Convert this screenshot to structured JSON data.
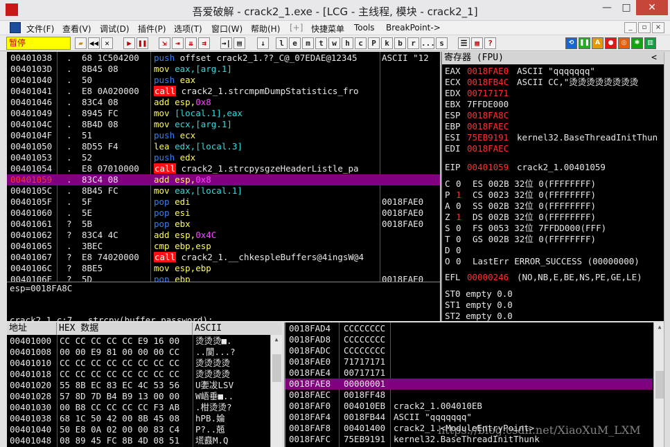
{
  "window": {
    "title": "吾爱破解 - crack2_1.exe - [LCG - 主线程, 模块 - crack2_1]",
    "icon_text": "吾爱破解",
    "controls": [
      "—",
      "□",
      "✕"
    ]
  },
  "menu": {
    "items": [
      "文件(F)",
      "查看(V)",
      "调试(D)",
      "插件(P)",
      "选项(T)",
      "窗口(W)",
      "帮助(H)",
      "[+]",
      "快捷菜单",
      "Tools",
      "BreakPoint->"
    ],
    "mdi_controls": [
      "_",
      "▫",
      "×"
    ]
  },
  "toolbar": {
    "status": "暂停",
    "letter_buttons": [
      "l",
      "e",
      "m",
      "t",
      "w",
      "h",
      "c",
      "P",
      "k",
      "b",
      "r",
      "...",
      "s"
    ]
  },
  "disasm": {
    "rows": [
      {
        "addr": "00401038",
        "mark": ".",
        "hex": "68 1C504200",
        "instr": [
          [
            "push",
            "b"
          ],
          [
            " offset crack2_1.??_C@_07EDAE@12345",
            "w"
          ]
        ],
        "cmt": "ASCII \"12"
      },
      {
        "addr": "0040103D",
        "mark": ".",
        "hex": "8B45 08",
        "instr": [
          [
            "mov",
            "y"
          ],
          [
            " eax,[arg.1]",
            "c"
          ]
        ],
        "cmt": ""
      },
      {
        "addr": "00401040",
        "mark": ".",
        "hex": "50",
        "instr": [
          [
            "push",
            "b"
          ],
          [
            " eax",
            "y"
          ]
        ],
        "cmt": ""
      },
      {
        "addr": "00401041",
        "mark": ".",
        "hex": "E8 0A020000",
        "instr": [
          [
            "call",
            "call"
          ],
          [
            " crack2_1.strcmpmDumpStatistics_fro",
            "w"
          ]
        ],
        "cmt": ""
      },
      {
        "addr": "00401046",
        "mark": ".",
        "hex": "83C4 08",
        "instr": [
          [
            "add",
            "y"
          ],
          [
            " esp,",
            "y"
          ],
          [
            "0x8",
            "m"
          ]
        ],
        "cmt": ""
      },
      {
        "addr": "00401049",
        "mark": ".",
        "hex": "8945 FC",
        "instr": [
          [
            "mov",
            "y"
          ],
          [
            " [local.1],eax",
            "c"
          ]
        ],
        "cmt": ""
      },
      {
        "addr": "0040104C",
        "mark": ".",
        "hex": "8B4D 08",
        "instr": [
          [
            "mov",
            "y"
          ],
          [
            " ecx,[arg.1]",
            "c"
          ]
        ],
        "cmt": ""
      },
      {
        "addr": "0040104F",
        "mark": ".",
        "hex": "51",
        "instr": [
          [
            "push",
            "b"
          ],
          [
            " ecx",
            "y"
          ]
        ],
        "cmt": ""
      },
      {
        "addr": "00401050",
        "mark": ".",
        "hex": "8D55 F4",
        "instr": [
          [
            "lea",
            "y"
          ],
          [
            " edx,[local.3]",
            "c"
          ]
        ],
        "cmt": ""
      },
      {
        "addr": "00401053",
        "mark": ".",
        "hex": "52",
        "instr": [
          [
            "push",
            "b"
          ],
          [
            " edx",
            "y"
          ]
        ],
        "cmt": ""
      },
      {
        "addr": "00401054",
        "mark": ".",
        "hex": "E8 07010000",
        "instr": [
          [
            "call",
            "call"
          ],
          [
            " crack2_1.strcpysgzeHeaderListle_pa",
            "w"
          ]
        ],
        "cmt": ""
      },
      {
        "addr": "00401059",
        "mark": ".",
        "hex": "83C4 08",
        "instr": [
          [
            "add",
            "y"
          ],
          [
            " esp,",
            "y"
          ],
          [
            "0x8",
            "m"
          ]
        ],
        "cmt": "",
        "selected": true
      },
      {
        "addr": "0040105C",
        "mark": ".",
        "hex": "8B45 FC",
        "instr": [
          [
            "mov",
            "y"
          ],
          [
            " eax,[local.1]",
            "c"
          ]
        ],
        "cmt": ""
      },
      {
        "addr": "0040105F",
        "mark": ".",
        "hex": "5F",
        "instr": [
          [
            "pop",
            "b"
          ],
          [
            " edi",
            "y"
          ]
        ],
        "cmt": "0018FAE0"
      },
      {
        "addr": "00401060",
        "mark": ".",
        "hex": "5E",
        "instr": [
          [
            "pop",
            "b"
          ],
          [
            " esi",
            "y"
          ]
        ],
        "cmt": "0018FAE0"
      },
      {
        "addr": "00401061",
        "mark": "?",
        "hex": "5B",
        "instr": [
          [
            "pop",
            "b"
          ],
          [
            " ebx",
            "y"
          ]
        ],
        "cmt": "0018FAE0"
      },
      {
        "addr": "00401062",
        "mark": "?",
        "hex": "83C4 4C",
        "instr": [
          [
            "add",
            "y"
          ],
          [
            " esp,",
            "y"
          ],
          [
            "0x4C",
            "m"
          ]
        ],
        "cmt": ""
      },
      {
        "addr": "00401065",
        "mark": ".",
        "hex": "3BEC",
        "instr": [
          [
            "cmp",
            "y"
          ],
          [
            " ebp,esp",
            "y"
          ]
        ],
        "cmt": ""
      },
      {
        "addr": "00401067",
        "mark": "?",
        "hex": "E8 74020000",
        "instr": [
          [
            "call",
            "call"
          ],
          [
            " crack2_1.__chkespleBuffers@4ingsW@4",
            "w"
          ]
        ],
        "cmt": ""
      },
      {
        "addr": "0040106C",
        "mark": "?",
        "hex": "8BE5",
        "instr": [
          [
            "mov",
            "y"
          ],
          [
            " esp,ebp",
            "y"
          ]
        ],
        "cmt": ""
      },
      {
        "addr": "0040106E",
        "mark": "?",
        "hex": "5D",
        "instr": [
          [
            "pop",
            "b"
          ],
          [
            " ebp",
            "y"
          ]
        ],
        "cmt": "0018FAE0"
      }
    ]
  },
  "info": {
    "line1": "esp=0018FA8C",
    "line2": "crack2_1.c:7.  strcpy(buffer,password);"
  },
  "registers": {
    "header": "寄存器 (FPU)",
    "collapse": "<",
    "gp": [
      {
        "name": "EAX",
        "val": "0018FAE0",
        "changed": true,
        "note": "ASCII \"qqqqqqq\""
      },
      {
        "name": "ECX",
        "val": "0018FB4C",
        "changed": true,
        "note": "ASCII CC,\"烫烫烫烫烫烫烫烫"
      },
      {
        "name": "EDX",
        "val": "00717171",
        "changed": true,
        "note": ""
      },
      {
        "name": "EBX",
        "val": "7FFDE000",
        "changed": false,
        "note": ""
      },
      {
        "name": "ESP",
        "val": "0018FA8C",
        "changed": true,
        "note": ""
      },
      {
        "name": "EBP",
        "val": "0018FAEC",
        "changed": true,
        "note": ""
      },
      {
        "name": "ESI",
        "val": "75EB9191",
        "changed": true,
        "note": "kernel32.BaseThreadInitThun"
      },
      {
        "name": "EDI",
        "val": "0018FAEC",
        "changed": true,
        "note": ""
      }
    ],
    "eip": {
      "name": "EIP",
      "val": "00401059",
      "note": "crack2_1.00401059"
    },
    "flags": [
      {
        "f": "C",
        "v": "0",
        "changed": false,
        "seg": "ES 002B 32位 0(FFFFFFFF)"
      },
      {
        "f": "P",
        "v": "1",
        "changed": true,
        "seg": "CS 0023 32位 0(FFFFFFFF)"
      },
      {
        "f": "A",
        "v": "0",
        "changed": false,
        "seg": "SS 002B 32位 0(FFFFFFFF)"
      },
      {
        "f": "Z",
        "v": "1",
        "changed": true,
        "seg": "DS 002B 32位 0(FFFFFFFF)"
      },
      {
        "f": "S",
        "v": "0",
        "changed": false,
        "seg": "FS 0053 32位 7FFDD000(FFF)"
      },
      {
        "f": "T",
        "v": "0",
        "changed": false,
        "seg": "GS 002B 32位 0(FFFFFFFF)"
      },
      {
        "f": "D",
        "v": "0",
        "changed": false,
        "seg": ""
      },
      {
        "f": "O",
        "v": "0",
        "changed": false,
        "seg": "LastErr ERROR_SUCCESS (00000000)"
      }
    ],
    "efl": {
      "name": "EFL",
      "val": "00000246",
      "note": "(NO,NB,E,BE,NS,PE,GE,LE)"
    },
    "fpu": [
      "ST0 empty 0.0",
      "ST1 empty 0.0",
      "ST2 empty 0.0"
    ]
  },
  "dump": {
    "headers": [
      "地址",
      "HEX 数据",
      "ASCII"
    ],
    "rows": [
      {
        "addr": "00401000",
        "hex": "CC CC CC CC CC E9 16 00",
        "ascii": "烫烫烫■."
      },
      {
        "addr": "00401008",
        "hex": "00 00 E9 81 00 00 00 CC",
        "ascii": "..閬...?"
      },
      {
        "addr": "00401010",
        "hex": "CC CC CC CC CC CC CC CC",
        "ascii": "烫烫烫烫"
      },
      {
        "addr": "00401018",
        "hex": "CC CC CC CC CC CC CC CC",
        "ascii": "烫烫烫烫"
      },
      {
        "addr": "00401020",
        "hex": "55 8B EC 83 EC 4C 53 56",
        "ascii": "U嬱冹LSV"
      },
      {
        "addr": "00401028",
        "hex": "57 8D 7D B4 B9 13 00 00",
        "ascii": "W峿垂■.."
      },
      {
        "addr": "00401030",
        "hex": "00 B8 CC CC CC CC F3 AB",
        "ascii": ".柑烫烫?"
      },
      {
        "addr": "00401038",
        "hex": "68 1C 50 42 00 8B 45 08",
        "ascii": "hPB.婨"
      },
      {
        "addr": "00401040",
        "hex": "50 E8 0A 02 00 00 83 C4",
        "ascii": "P?..兡"
      },
      {
        "addr": "00401048",
        "hex": "08 89 45 FC 8B 4D 08 51",
        "ascii": "塃鼖M.Q"
      }
    ]
  },
  "stack": {
    "rows": [
      {
        "addr": "0018FAD4",
        "val": "CCCCCCCC",
        "note": ""
      },
      {
        "addr": "0018FAD8",
        "val": "CCCCCCCC",
        "note": ""
      },
      {
        "addr": "0018FADC",
        "val": "CCCCCCCC",
        "note": ""
      },
      {
        "addr": "0018FAE0",
        "val": "71717171",
        "note": ""
      },
      {
        "addr": "0018FAE4",
        "val": "00717171",
        "note": ""
      },
      {
        "addr": "0018FAE8",
        "val": "00000001",
        "note": "",
        "selected": true
      },
      {
        "addr": "0018FAEC",
        "val": "0018FF48",
        "note": ""
      },
      {
        "addr": "0018FAF0",
        "val": "004010EB",
        "note": "crack2_1.004010EB"
      },
      {
        "addr": "0018FAF4",
        "val": "0018FB44",
        "note": "ASCII \"qqqqqqq\""
      },
      {
        "addr": "0018FAF8",
        "val": "00401400",
        "note": "crack2_1.<ModuleEntryPoint>"
      },
      {
        "addr": "0018FAFC",
        "val": "75EB9191",
        "note": "kernel32.BaseThreadInitThunk"
      }
    ],
    "watermark": "https://blog.csdn.net/XiaoXuM_LXM"
  },
  "colors": {
    "selection": "#800080",
    "changed_reg": "#ff2020",
    "call_bg": "#ff1010",
    "status_bg": "#ffff00"
  }
}
